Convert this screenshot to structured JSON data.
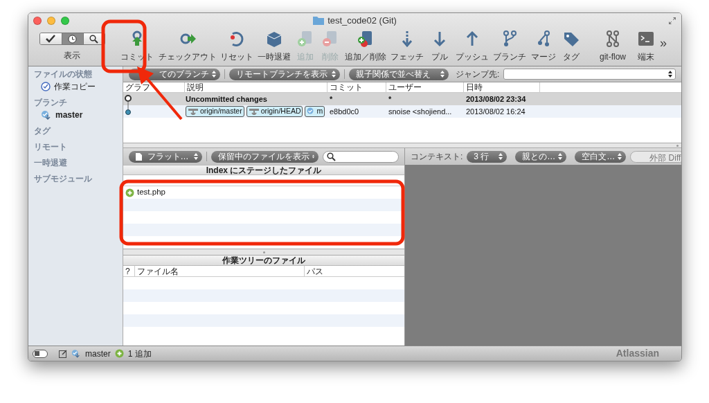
{
  "window": {
    "title": "test_code02 (Git)"
  },
  "view_switch": {
    "label": "表示",
    "segments": [
      {
        "kind": "check",
        "selected": false
      },
      {
        "kind": "history",
        "selected": true
      },
      {
        "kind": "search",
        "selected": false
      }
    ]
  },
  "toolbar": [
    {
      "kind": "commit",
      "label": "コミット",
      "disabled": false
    },
    {
      "kind": "checkout",
      "label": "チェックアウト",
      "disabled": false
    },
    {
      "kind": "reset",
      "label": "リセット",
      "disabled": false
    },
    {
      "kind": "stash",
      "label": "一時退避",
      "disabled": false
    },
    {
      "kind": "add",
      "label": "追加",
      "disabled": true
    },
    {
      "kind": "remove",
      "label": "削除",
      "disabled": true
    },
    {
      "kind": "addremove",
      "label": "追加／削除",
      "disabled": false
    },
    {
      "kind": "fetch",
      "label": "フェッチ",
      "disabled": false
    },
    {
      "kind": "pull",
      "label": "プル",
      "disabled": false
    },
    {
      "kind": "push",
      "label": "プッシュ",
      "disabled": false
    },
    {
      "kind": "branch",
      "label": "ブランチ",
      "disabled": false
    },
    {
      "kind": "merge",
      "label": "マージ",
      "disabled": false
    },
    {
      "kind": "tag",
      "label": "タグ",
      "disabled": false
    },
    {
      "kind": "gitflow",
      "label": "git-flow",
      "disabled": false
    },
    {
      "kind": "terminal",
      "label": "端末",
      "disabled": false
    }
  ],
  "toolbar_overflow": "»",
  "sidebar": [
    {
      "heading": "ファイルの状態",
      "items": [
        {
          "kind": "working-copy",
          "label": "作業コピー"
        }
      ]
    },
    {
      "heading": "ブランチ",
      "items": [
        {
          "kind": "branch",
          "label": "master"
        }
      ]
    },
    {
      "heading": "タグ"
    },
    {
      "heading": "リモート"
    },
    {
      "heading": "一時退避"
    },
    {
      "heading": "サブモジュール"
    }
  ],
  "log_filters": [
    "てのブランチ",
    "リモートブランチを表示",
    "親子関係で並べ替え"
  ],
  "jump": {
    "label": "ジャンプ先:"
  },
  "log_table": {
    "columns": [
      "グラフ",
      "説明",
      "コミット",
      "ユーザー",
      "日時"
    ],
    "rows": [
      {
        "kind": "uncommitted",
        "description": "Uncommitted changes",
        "labels": [],
        "commit": "*",
        "user": "*",
        "date": "2013/08/02 23:34",
        "selected": true
      },
      {
        "kind": "commit",
        "labels": [
          {
            "kind": "remote",
            "text": "origin/master"
          },
          {
            "kind": "remote",
            "text": "origin/HEAD"
          },
          {
            "kind": "local",
            "text": "m"
          }
        ],
        "commit": "e8bd0c0",
        "user": "snoise <shojiend...",
        "date": "2013/08/02 16:24",
        "selected": false
      }
    ]
  },
  "file_filters": {
    "mode": "フラット…",
    "show": "保留中のファイルを表示"
  },
  "staged": {
    "title": "Index にステージしたファイル",
    "files": [
      {
        "kind": "added",
        "name": "test.php"
      }
    ]
  },
  "working_tree": {
    "title": "作業ツリーのファイル",
    "columns": [
      "?",
      "ファイル名",
      "パス"
    ]
  },
  "diff_toolbar": {
    "context_label": "コンテキスト:",
    "context": "3 行",
    "parent": "親との…",
    "whitespace": "空白文…",
    "external": "外部 Diff"
  },
  "status_bar": {
    "branch": "master",
    "changes": "1 追加",
    "brand": "Atlassian"
  },
  "annotations": [
    {
      "kind": "box"
    },
    {
      "kind": "arrow"
    },
    {
      "kind": "box"
    }
  ]
}
